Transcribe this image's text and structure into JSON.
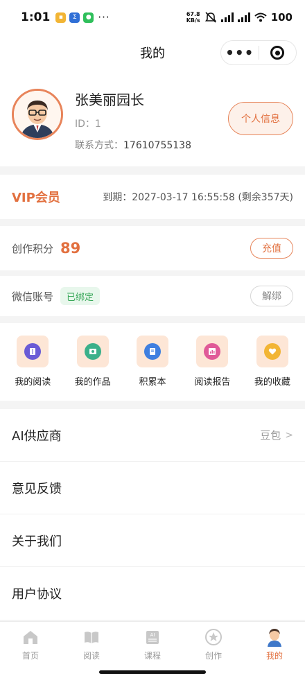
{
  "status_bar": {
    "time": "1:01",
    "more": "···",
    "net_speed_value": "67.8",
    "net_speed_unit": "KB/s",
    "battery": "100"
  },
  "nav": {
    "title": "我的",
    "more_label": "•••"
  },
  "profile": {
    "name": "张美丽园长",
    "id_text": "ID：1",
    "contact_label": "联系方式：",
    "contact_value": "17610755138",
    "info_button": "个人信息"
  },
  "vip": {
    "label": "VIP会员",
    "expire_text": "到期：2027-03-17 16:55:58 (剩余357天)"
  },
  "credits": {
    "label": "创作积分",
    "value": "89",
    "recharge_button": "充值"
  },
  "wechat": {
    "label": "微信账号",
    "badge": "已绑定",
    "unbind_button": "解绑"
  },
  "quick_actions": [
    {
      "label": "我的阅读",
      "icon": "book-icon",
      "color": "#6a5bd6"
    },
    {
      "label": "我的作品",
      "icon": "picture-icon",
      "color": "#3bb08a"
    },
    {
      "label": "积累本",
      "icon": "notebook-icon",
      "color": "#3f7fe0"
    },
    {
      "label": "阅读报告",
      "icon": "chart-icon",
      "color": "#e05a98"
    },
    {
      "label": "我的收藏",
      "icon": "heart-icon",
      "color": "#f2b535"
    }
  ],
  "menu": [
    {
      "label": "AI供应商",
      "value": "豆包",
      "chevron": ">"
    },
    {
      "label": "意见反馈"
    },
    {
      "label": "关于我们"
    },
    {
      "label": "用户协议"
    }
  ],
  "tabs": [
    {
      "label": "首页",
      "icon": "home-icon",
      "active": false
    },
    {
      "label": "阅读",
      "icon": "open-book-icon",
      "active": false
    },
    {
      "label": "课程",
      "icon": "course-icon",
      "active": false
    },
    {
      "label": "创作",
      "icon": "star-icon",
      "active": false
    },
    {
      "label": "我的",
      "icon": "avatar-icon",
      "active": true
    }
  ],
  "colors": {
    "accent": "#e2703f",
    "accent_bg": "#fdf1ea",
    "bound_green": "#39a85a",
    "page_bg": "#f4f4f4"
  }
}
